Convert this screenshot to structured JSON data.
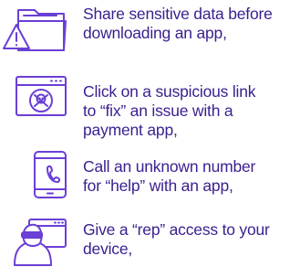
{
  "colors": {
    "text": "#3b1f8f",
    "icon_stroke": "#6a3fd6",
    "background": "#ffffff"
  },
  "items": [
    {
      "icon": "folder-warning-icon",
      "text": "Share sensitive data before\ndownloading an app,"
    },
    {
      "icon": "browser-danger-icon",
      "text": "Click on a suspicious link\nto “fix” an issue with a\npayment app,"
    },
    {
      "icon": "phone-call-icon",
      "text": "Call an unknown number\nfor “help” with an app,"
    },
    {
      "icon": "hacker-device-icon",
      "text": "Give a “rep” access to your\ndevice,"
    }
  ]
}
